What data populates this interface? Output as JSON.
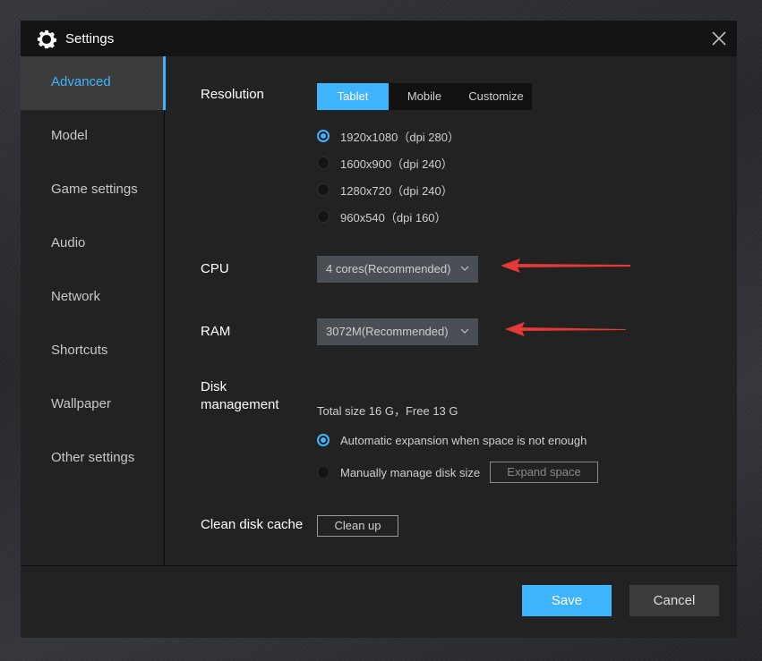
{
  "window": {
    "title": "Settings",
    "title_icon": "gear-icon",
    "close_icon": "close-icon"
  },
  "sidebar": {
    "active_index": 0,
    "items": [
      {
        "label": "Advanced"
      },
      {
        "label": "Model"
      },
      {
        "label": "Game settings"
      },
      {
        "label": "Audio"
      },
      {
        "label": "Network"
      },
      {
        "label": "Shortcuts"
      },
      {
        "label": "Wallpaper"
      },
      {
        "label": "Other settings"
      }
    ]
  },
  "resolution": {
    "label": "Resolution",
    "tabs": [
      {
        "label": "Tablet",
        "selected": true
      },
      {
        "label": "Mobile",
        "selected": false
      },
      {
        "label": "Customize",
        "selected": false
      }
    ],
    "options": [
      {
        "label": "1920x1080（dpi 280）",
        "checked": true
      },
      {
        "label": "1600x900（dpi 240）",
        "checked": false
      },
      {
        "label": "1280x720（dpi 240）",
        "checked": false
      },
      {
        "label": "960x540（dpi 160）",
        "checked": false
      }
    ]
  },
  "cpu": {
    "label": "CPU",
    "value": "4 cores(Recommended)"
  },
  "ram": {
    "label": "RAM",
    "value": "3072M(Recommended)"
  },
  "annotations": {
    "arrow_color": "#e53935"
  },
  "disk": {
    "label_line1": "Disk",
    "label_line2": "management",
    "info": "Total size 16 G，Free 13 G",
    "options": [
      {
        "label": "Automatic expansion when space is not enough",
        "checked": true
      },
      {
        "label": "Manually manage disk size",
        "checked": false
      }
    ],
    "expand_button": "Expand space"
  },
  "cache": {
    "label": "Clean disk cache",
    "button": "Clean up"
  },
  "footer": {
    "save": "Save",
    "cancel": "Cancel"
  },
  "colors": {
    "accent": "#3eb4ff",
    "dialog_bg": "#222222",
    "titlebar_bg": "#131313",
    "sidebar_active_bg": "#3c3c3c"
  }
}
